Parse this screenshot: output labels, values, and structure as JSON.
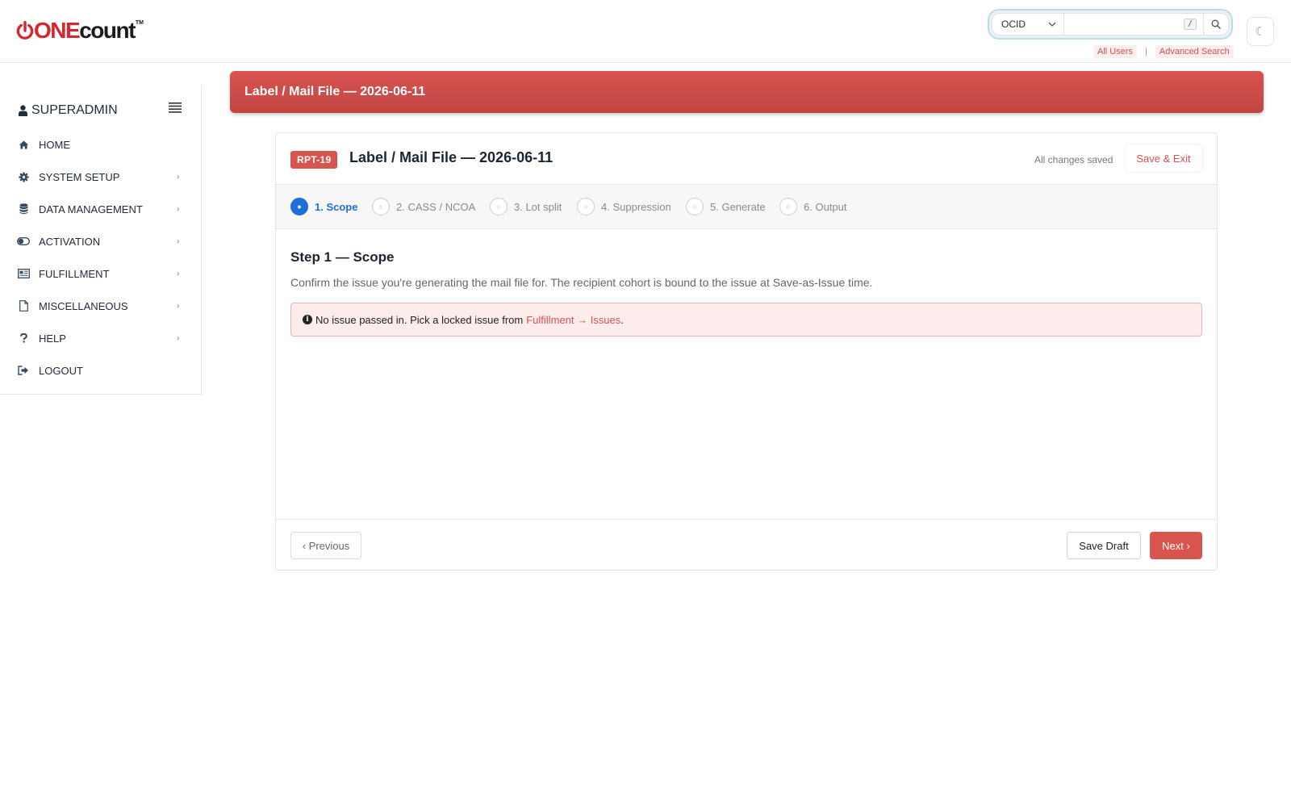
{
  "header": {
    "logo": {
      "part1": "ONE",
      "part2": "count",
      "tm": "TM"
    },
    "search": {
      "scope_selected": "OCID",
      "input_value": "",
      "placeholder": "",
      "shortcut_key": "/",
      "search_icon": "magnifier-icon"
    },
    "links": {
      "all_users": "All Users",
      "separator": "|",
      "advanced_search": "Advanced Search"
    },
    "theme_toggle_icon": "☾"
  },
  "sidebar": {
    "user": "SUPERADMIN",
    "items": [
      {
        "label": "HOME",
        "icon": "home-icon",
        "has_submenu": false
      },
      {
        "label": "SYSTEM SETUP",
        "icon": "gear-icon",
        "has_submenu": true
      },
      {
        "label": "DATA MANAGEMENT",
        "icon": "database-icon",
        "has_submenu": true
      },
      {
        "label": "ACTIVATION",
        "icon": "toggle-icon",
        "has_submenu": true
      },
      {
        "label": "FULFILLMENT",
        "icon": "newspaper-icon",
        "has_submenu": true
      },
      {
        "label": "MISCELLANEOUS",
        "icon": "file-icon",
        "has_submenu": true
      },
      {
        "label": "HELP",
        "icon": "question-icon",
        "has_submenu": true
      },
      {
        "label": "LOGOUT",
        "icon": "sign-out-icon",
        "has_submenu": false
      }
    ],
    "chevron": "›"
  },
  "banner": {
    "title": "Label / Mail File — 2026-06-11"
  },
  "card": {
    "badge": "RPT-19",
    "title": "Label / Mail File — 2026-06-11",
    "saved_status": "All changes saved",
    "save_exit_label": "Save & Exit",
    "steps": [
      {
        "label": "1. Scope",
        "active": true,
        "marker": "●"
      },
      {
        "label": "2. CASS / NCOA",
        "active": false,
        "marker": "○"
      },
      {
        "label": "3. Lot split",
        "active": false,
        "marker": "○"
      },
      {
        "label": "4. Suppression",
        "active": false,
        "marker": "○"
      },
      {
        "label": "5. Generate",
        "active": false,
        "marker": "○"
      },
      {
        "label": "6. Output",
        "active": false,
        "marker": "○"
      }
    ],
    "step_heading": "Step 1 — Scope",
    "step_description": "Confirm the issue you're generating the mail file for. The recipient cohort is bound to the issue at Save-as-Issue time.",
    "alert": {
      "icon": "i",
      "text": "No issue passed in. Pick a locked issue from",
      "link_text": "Fulfillment → Issues",
      "suffix": "."
    },
    "footer": {
      "previous_label": "‹ Previous",
      "save_draft_label": "Save Draft",
      "next_label": "Next ›"
    }
  },
  "colors": {
    "brand_red": "#d9534f",
    "active_step_blue": "#1e6fd9",
    "alert_bg": "#fcecec",
    "alert_border": "#eab4b4"
  }
}
